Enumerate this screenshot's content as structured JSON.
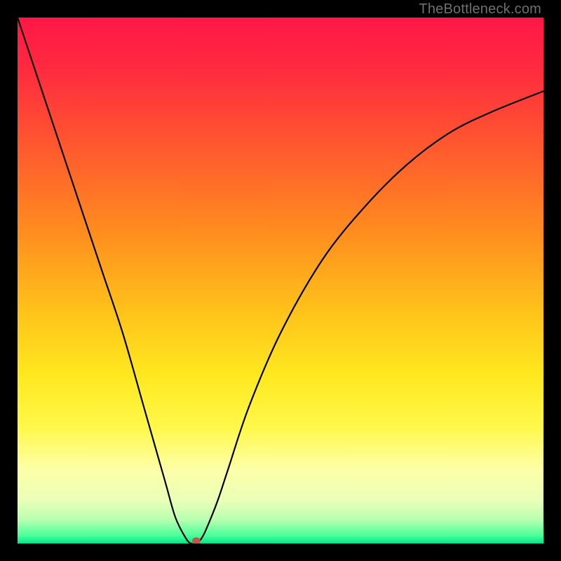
{
  "watermark": {
    "text": "TheBottleneck.com"
  },
  "chart_data": {
    "type": "line",
    "title": "",
    "xlabel": "",
    "ylabel": "",
    "xlim": [
      0,
      100
    ],
    "ylim": [
      0,
      100
    ],
    "grid": false,
    "legend": false,
    "gradient_stops": [
      {
        "offset": 0,
        "color": "#ff1747"
      },
      {
        "offset": 0.1,
        "color": "#ff2b3f"
      },
      {
        "offset": 0.25,
        "color": "#ff5a2e"
      },
      {
        "offset": 0.4,
        "color": "#ff8a1f"
      },
      {
        "offset": 0.55,
        "color": "#ffbf1a"
      },
      {
        "offset": 0.68,
        "color": "#ffe81f"
      },
      {
        "offset": 0.78,
        "color": "#fff84a"
      },
      {
        "offset": 0.86,
        "color": "#fdffa8"
      },
      {
        "offset": 0.92,
        "color": "#e8ffb8"
      },
      {
        "offset": 0.955,
        "color": "#b8ffb0"
      },
      {
        "offset": 0.985,
        "color": "#4bff9a"
      },
      {
        "offset": 1.0,
        "color": "#00e58c"
      }
    ],
    "series": [
      {
        "name": "bottleneck-curve",
        "x": [
          0,
          4,
          8,
          12,
          16,
          20,
          24,
          28,
          30,
          32,
          33,
          34,
          35,
          36,
          38,
          40,
          44,
          50,
          58,
          66,
          74,
          82,
          90,
          100
        ],
        "y": [
          100,
          88,
          76,
          64,
          52,
          40,
          26,
          12,
          5,
          1,
          0,
          0,
          1,
          3,
          8,
          14,
          26,
          40,
          54,
          64,
          72,
          78,
          82,
          86
        ]
      }
    ],
    "marker": {
      "x": 34,
      "y": 0.5,
      "color": "#c0584a",
      "rx": 6,
      "ry": 5
    }
  }
}
